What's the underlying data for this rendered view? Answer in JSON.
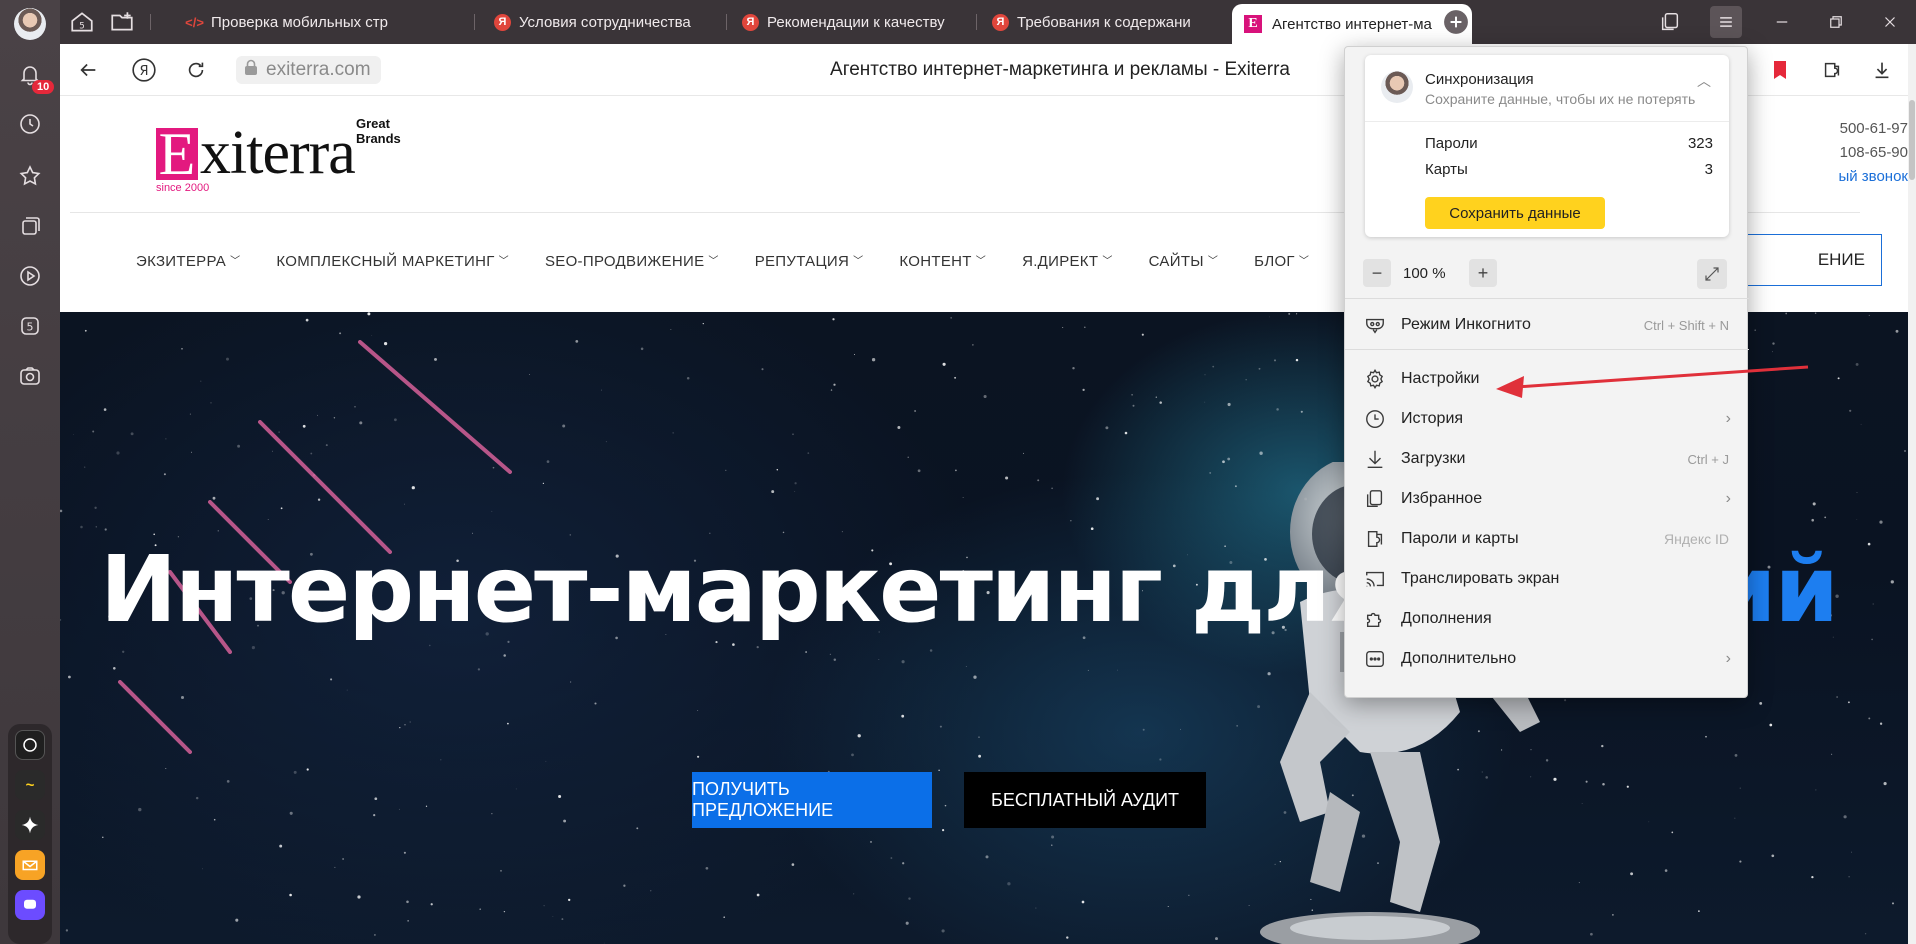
{
  "sidebar": {
    "notification_count": "10",
    "items": [
      {
        "name": "bell-icon"
      },
      {
        "name": "history-icon"
      },
      {
        "name": "star-icon"
      },
      {
        "name": "collections-icon"
      },
      {
        "name": "play-icon"
      },
      {
        "name": "number-five-icon"
      },
      {
        "name": "camera-icon"
      }
    ]
  },
  "tabs": [
    {
      "title": "Проверка мобильных стр",
      "favicon": "code-icon",
      "color": "#e0463c"
    },
    {
      "title": "Условия сотрудничества",
      "favicon": "yandex-icon",
      "color": "#e0463c"
    },
    {
      "title": "Рекомендации к качеству",
      "favicon": "yandex-icon",
      "color": "#e0463c"
    },
    {
      "title": "Требования к содержани",
      "favicon": "yandex-icon",
      "color": "#e0463c"
    }
  ],
  "active_tab": {
    "title": "Агентство интернет-ма",
    "favicon_letter": "E"
  },
  "address": {
    "url": "exiterra.com",
    "page_title": "Агентство интернет-маркетинга и рекламы - Exiterra"
  },
  "site": {
    "logo_letter": "E",
    "logo_rest": "xiterra",
    "logo_great": "Great Brands",
    "logo_since": "since 2000",
    "phone1": "500-61-97",
    "phone2": "108-65-90",
    "callback": "ый звонок",
    "nav": [
      "ЭКЗИТЕРРА",
      "КОМПЛЕКСНЫЙ МАРКЕТИНГ",
      "SEO-ПРОДВИЖЕНИЕ",
      "РЕПУТАЦИЯ",
      "КОНТЕНТ",
      "Я.ДИРЕКТ",
      "САЙТЫ",
      "БЛОГ"
    ],
    "nav_cta": "ЕНИЕ",
    "hero_title": "Интернет-маркетинг для ",
    "hero_accent": "ий",
    "btn_offer": "ПОЛУЧИТЬ ПРЕДЛОЖЕНИЕ",
    "btn_audit": "БЕСПЛАТНЫЙ АУДИТ"
  },
  "menu": {
    "sync_title": "Синхронизация",
    "sync_sub": "Сохраните данные, чтобы их не потерять",
    "passwords_label": "Пароли",
    "passwords_count": "323",
    "cards_label": "Карты",
    "cards_count": "3",
    "save_button": "Сохранить данные",
    "zoom_minus": "−",
    "zoom_value": "100 %",
    "zoom_plus": "+",
    "items": [
      {
        "label": "Режим Инкогнито",
        "right": "Ctrl + Shift + N"
      },
      {
        "label": "Настройки",
        "right": ""
      },
      {
        "label": "История",
        "right": "›"
      },
      {
        "label": "Загрузки",
        "right": "Ctrl + J"
      },
      {
        "label": "Избранное",
        "right": "›"
      },
      {
        "label": "Пароли и карты",
        "right": "Яндекс ID"
      },
      {
        "label": "Транслировать экран",
        "right": ""
      },
      {
        "label": "Дополнения",
        "right": ""
      },
      {
        "label": "Дополнительно",
        "right": "›"
      }
    ]
  },
  "colors": {
    "accent_pink": "#e3197f",
    "accent_blue": "#0b6fe8",
    "save_yellow": "#ffd21e",
    "annotation_red": "#e0303a"
  }
}
